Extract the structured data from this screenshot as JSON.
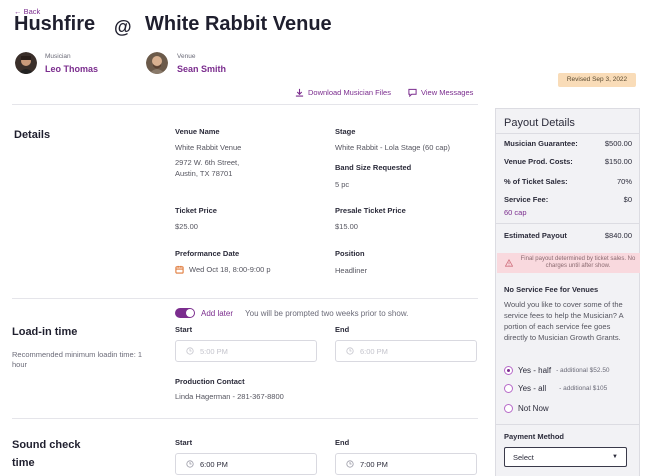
{
  "header": {
    "back_label": "← Back",
    "musician_title": "Hushfire",
    "at": "@",
    "venue_title": "White Rabbit Venue"
  },
  "people": {
    "musician_role": "Musician",
    "musician_name": "Leo Thomas",
    "venue_role": "Venue",
    "venue_name": "Sean Smith"
  },
  "revised_badge": "Revised Sep 3, 2022",
  "actions": {
    "download_files": "Download Musician Files",
    "view_messages": "View Messages"
  },
  "details": {
    "section_title": "Details",
    "venue_name_label": "Venue Name",
    "venue_name": "White Rabbit Venue",
    "address_line1": "2972 W. 6th Street,",
    "address_line2": "Austin, TX 78701",
    "stage_label": "Stage",
    "stage": "White Rabbit - Lola Stage (60 cap)",
    "band_size_label": "Band Size Requested",
    "band_size": "5 pc",
    "ticket_price_label": "Ticket Price",
    "ticket_price": "$25.00",
    "presale_label": "Presale Ticket Price",
    "presale": "$15.00",
    "performance_date_label": "Preformance Date",
    "performance_date": "Wed Oct 18, 8:00-9:00 p",
    "position_label": "Position",
    "position": "Headliner"
  },
  "loadin": {
    "toggle_label": "Add later",
    "toggle_note": "You will be prompted two weeks prior to show.",
    "section_title": "Load-in time",
    "hint": "Recommended minimum loadin time: 1 hour",
    "start_label": "Start",
    "start_placeholder": "5:00 PM",
    "end_label": "End",
    "end_placeholder": "6:00 PM",
    "contact_label": "Production Contact",
    "contact_value": "Linda Hagerman - 281-367-8800"
  },
  "soundcheck": {
    "section_title_line1": "Sound check",
    "section_title_line2": "time",
    "start_label": "Start",
    "start_value": "6:00 PM",
    "end_label": "End",
    "end_value": "7:00 PM"
  },
  "payout": {
    "title": "Payout Details",
    "rows": [
      {
        "label": "Musician Guarantee:",
        "value": "$500.00"
      },
      {
        "label": "Venue Prod. Costs:",
        "value": "$150.00"
      },
      {
        "label": "% of Ticket Sales:",
        "value": "70%"
      },
      {
        "label": "Service Fee:",
        "value": "$0"
      }
    ],
    "cap_note": "60 cap",
    "estimated_label": "Estimated Payout",
    "estimated_value": "$840.00",
    "warning": "Final payout determined by ticket sales. No charges until after show.",
    "no_fee_title": "No Service Fee for Venues",
    "no_fee_text": "Would you like to cover some of the service fees to help the Musician? A portion of each service fee goes directly to Musician Growth Grants.",
    "options": [
      {
        "label": "Yes - half",
        "extra": "- additional $52.50",
        "selected": true
      },
      {
        "label": "Yes - all",
        "extra": "- additional $105",
        "selected": false
      },
      {
        "label": "Not Now",
        "extra": "",
        "selected": false
      }
    ],
    "payment_label": "Payment Method",
    "payment_select": "Select"
  },
  "colors": {
    "accent": "#7b2d8e",
    "badge": "#f9dcb8",
    "warning_bg": "#f9d9de",
    "panel_bg": "#f2f2f5"
  }
}
